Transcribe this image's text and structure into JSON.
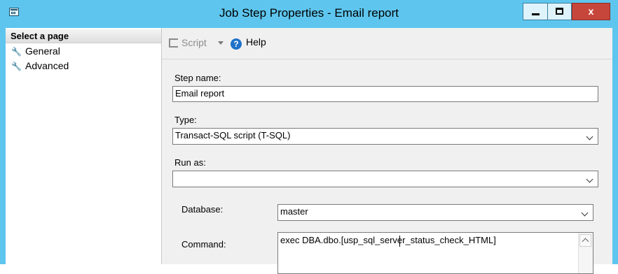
{
  "window": {
    "title": "Job Step Properties - Email report",
    "close_label": "x"
  },
  "left_pane": {
    "header": "Select a page",
    "items": [
      {
        "label": "General",
        "icon": "wrench-icon"
      },
      {
        "label": "Advanced",
        "icon": "wrench-icon"
      }
    ]
  },
  "toolbar": {
    "script_label": "Script",
    "help_label": "Help",
    "help_icon_glyph": "?"
  },
  "form": {
    "step_name_label": "Step name:",
    "step_name_value": "Email report",
    "type_label": "Type:",
    "type_value": "Transact-SQL script (T-SQL)",
    "run_as_label": "Run as:",
    "run_as_value": "",
    "database_label": "Database:",
    "database_value": "master",
    "command_label": "Command:",
    "command_value": "exec DBA.dbo.[usp_sql_server_status_check_HTML]"
  },
  "colors": {
    "frame": "#5ec6ee",
    "close_button": "#c7463b",
    "help_icon": "#1e72c9"
  }
}
